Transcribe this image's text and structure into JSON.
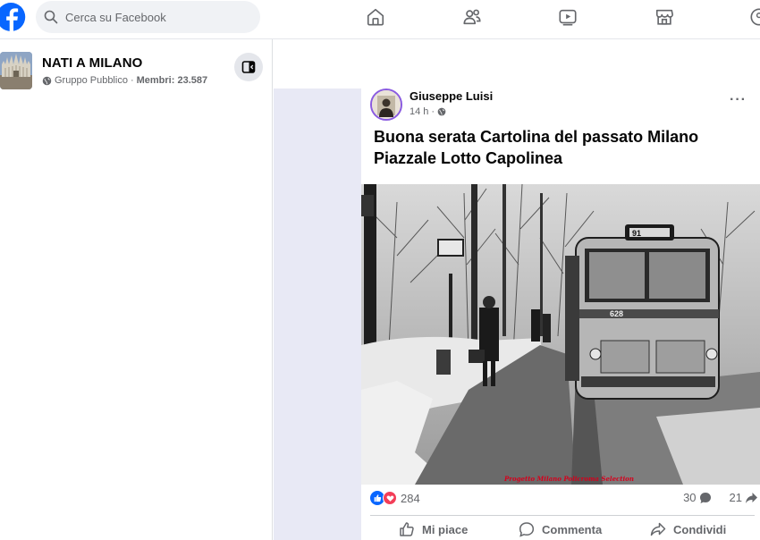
{
  "header": {
    "search_placeholder": "Cerca su Facebook",
    "nav_icons": [
      "home-icon",
      "friends-icon",
      "video-icon",
      "marketplace-icon",
      "groups-icon"
    ]
  },
  "group": {
    "name": "NATI A MILANO",
    "privacy": "Gruppo Pubblico",
    "separator": "·",
    "members_label": "Membri: 23.587"
  },
  "post": {
    "author": "Giuseppe Luisi",
    "time": "14 h",
    "time_separator": "·",
    "text_line1": "Buona serata Cartolina del passato Milano",
    "text_line2": "Piazzale Lotto Capolinea",
    "photo_caption": "Progetto Milano Policroma Selection",
    "bus_number": "628",
    "bus_sign": "91",
    "reaction_count": "284",
    "comment_count": "30",
    "share_count": "21",
    "actions": {
      "like": "Mi piace",
      "comment": "Commenta",
      "share": "Condividi"
    }
  },
  "colors": {
    "brand": "#0866ff",
    "background_band": "#e8e9f5",
    "love": "#f33e58",
    "text_secondary": "#65676b"
  }
}
